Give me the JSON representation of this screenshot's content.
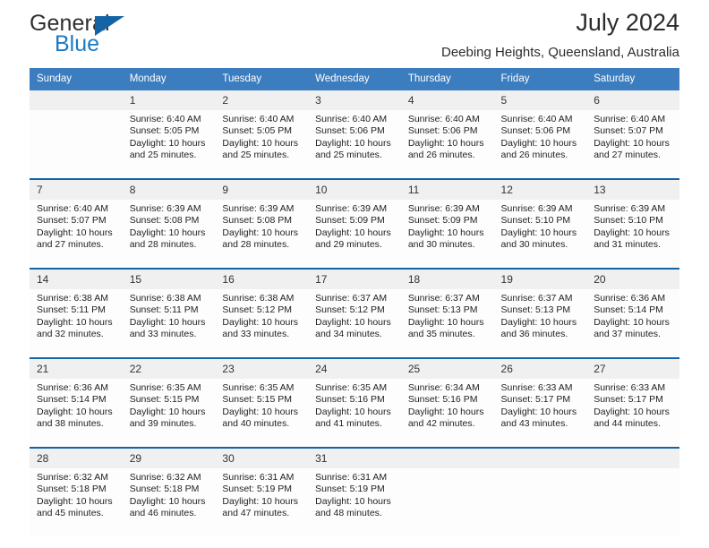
{
  "logo": {
    "word1": "General",
    "word2": "Blue",
    "triangle_color": "#1464a5",
    "blue_color": "#1b7bc4"
  },
  "header": {
    "title": "July 2024",
    "subtitle": "Deebing Heights, Queensland, Australia"
  },
  "theme": {
    "header_blue": "#3b7dbf",
    "separator_blue": "#1464a5",
    "number_band": "#f0f0f0",
    "cell_background": "#fdfdfd"
  },
  "weekdays": [
    "Sunday",
    "Monday",
    "Tuesday",
    "Wednesday",
    "Thursday",
    "Friday",
    "Saturday"
  ],
  "weeks": [
    [
      {
        "day": "",
        "sunrise": "",
        "sunset": "",
        "daylight_line1": "",
        "daylight_line2": ""
      },
      {
        "day": "1",
        "sunrise": "Sunrise: 6:40 AM",
        "sunset": "Sunset: 5:05 PM",
        "daylight_line1": "Daylight: 10 hours",
        "daylight_line2": "and 25 minutes."
      },
      {
        "day": "2",
        "sunrise": "Sunrise: 6:40 AM",
        "sunset": "Sunset: 5:05 PM",
        "daylight_line1": "Daylight: 10 hours",
        "daylight_line2": "and 25 minutes."
      },
      {
        "day": "3",
        "sunrise": "Sunrise: 6:40 AM",
        "sunset": "Sunset: 5:06 PM",
        "daylight_line1": "Daylight: 10 hours",
        "daylight_line2": "and 25 minutes."
      },
      {
        "day": "4",
        "sunrise": "Sunrise: 6:40 AM",
        "sunset": "Sunset: 5:06 PM",
        "daylight_line1": "Daylight: 10 hours",
        "daylight_line2": "and 26 minutes."
      },
      {
        "day": "5",
        "sunrise": "Sunrise: 6:40 AM",
        "sunset": "Sunset: 5:06 PM",
        "daylight_line1": "Daylight: 10 hours",
        "daylight_line2": "and 26 minutes."
      },
      {
        "day": "6",
        "sunrise": "Sunrise: 6:40 AM",
        "sunset": "Sunset: 5:07 PM",
        "daylight_line1": "Daylight: 10 hours",
        "daylight_line2": "and 27 minutes."
      }
    ],
    [
      {
        "day": "7",
        "sunrise": "Sunrise: 6:40 AM",
        "sunset": "Sunset: 5:07 PM",
        "daylight_line1": "Daylight: 10 hours",
        "daylight_line2": "and 27 minutes."
      },
      {
        "day": "8",
        "sunrise": "Sunrise: 6:39 AM",
        "sunset": "Sunset: 5:08 PM",
        "daylight_line1": "Daylight: 10 hours",
        "daylight_line2": "and 28 minutes."
      },
      {
        "day": "9",
        "sunrise": "Sunrise: 6:39 AM",
        "sunset": "Sunset: 5:08 PM",
        "daylight_line1": "Daylight: 10 hours",
        "daylight_line2": "and 28 minutes."
      },
      {
        "day": "10",
        "sunrise": "Sunrise: 6:39 AM",
        "sunset": "Sunset: 5:09 PM",
        "daylight_line1": "Daylight: 10 hours",
        "daylight_line2": "and 29 minutes."
      },
      {
        "day": "11",
        "sunrise": "Sunrise: 6:39 AM",
        "sunset": "Sunset: 5:09 PM",
        "daylight_line1": "Daylight: 10 hours",
        "daylight_line2": "and 30 minutes."
      },
      {
        "day": "12",
        "sunrise": "Sunrise: 6:39 AM",
        "sunset": "Sunset: 5:10 PM",
        "daylight_line1": "Daylight: 10 hours",
        "daylight_line2": "and 30 minutes."
      },
      {
        "day": "13",
        "sunrise": "Sunrise: 6:39 AM",
        "sunset": "Sunset: 5:10 PM",
        "daylight_line1": "Daylight: 10 hours",
        "daylight_line2": "and 31 minutes."
      }
    ],
    [
      {
        "day": "14",
        "sunrise": "Sunrise: 6:38 AM",
        "sunset": "Sunset: 5:11 PM",
        "daylight_line1": "Daylight: 10 hours",
        "daylight_line2": "and 32 minutes."
      },
      {
        "day": "15",
        "sunrise": "Sunrise: 6:38 AM",
        "sunset": "Sunset: 5:11 PM",
        "daylight_line1": "Daylight: 10 hours",
        "daylight_line2": "and 33 minutes."
      },
      {
        "day": "16",
        "sunrise": "Sunrise: 6:38 AM",
        "sunset": "Sunset: 5:12 PM",
        "daylight_line1": "Daylight: 10 hours",
        "daylight_line2": "and 33 minutes."
      },
      {
        "day": "17",
        "sunrise": "Sunrise: 6:37 AM",
        "sunset": "Sunset: 5:12 PM",
        "daylight_line1": "Daylight: 10 hours",
        "daylight_line2": "and 34 minutes."
      },
      {
        "day": "18",
        "sunrise": "Sunrise: 6:37 AM",
        "sunset": "Sunset: 5:13 PM",
        "daylight_line1": "Daylight: 10 hours",
        "daylight_line2": "and 35 minutes."
      },
      {
        "day": "19",
        "sunrise": "Sunrise: 6:37 AM",
        "sunset": "Sunset: 5:13 PM",
        "daylight_line1": "Daylight: 10 hours",
        "daylight_line2": "and 36 minutes."
      },
      {
        "day": "20",
        "sunrise": "Sunrise: 6:36 AM",
        "sunset": "Sunset: 5:14 PM",
        "daylight_line1": "Daylight: 10 hours",
        "daylight_line2": "and 37 minutes."
      }
    ],
    [
      {
        "day": "21",
        "sunrise": "Sunrise: 6:36 AM",
        "sunset": "Sunset: 5:14 PM",
        "daylight_line1": "Daylight: 10 hours",
        "daylight_line2": "and 38 minutes."
      },
      {
        "day": "22",
        "sunrise": "Sunrise: 6:35 AM",
        "sunset": "Sunset: 5:15 PM",
        "daylight_line1": "Daylight: 10 hours",
        "daylight_line2": "and 39 minutes."
      },
      {
        "day": "23",
        "sunrise": "Sunrise: 6:35 AM",
        "sunset": "Sunset: 5:15 PM",
        "daylight_line1": "Daylight: 10 hours",
        "daylight_line2": "and 40 minutes."
      },
      {
        "day": "24",
        "sunrise": "Sunrise: 6:35 AM",
        "sunset": "Sunset: 5:16 PM",
        "daylight_line1": "Daylight: 10 hours",
        "daylight_line2": "and 41 minutes."
      },
      {
        "day": "25",
        "sunrise": "Sunrise: 6:34 AM",
        "sunset": "Sunset: 5:16 PM",
        "daylight_line1": "Daylight: 10 hours",
        "daylight_line2": "and 42 minutes."
      },
      {
        "day": "26",
        "sunrise": "Sunrise: 6:33 AM",
        "sunset": "Sunset: 5:17 PM",
        "daylight_line1": "Daylight: 10 hours",
        "daylight_line2": "and 43 minutes."
      },
      {
        "day": "27",
        "sunrise": "Sunrise: 6:33 AM",
        "sunset": "Sunset: 5:17 PM",
        "daylight_line1": "Daylight: 10 hours",
        "daylight_line2": "and 44 minutes."
      }
    ],
    [
      {
        "day": "28",
        "sunrise": "Sunrise: 6:32 AM",
        "sunset": "Sunset: 5:18 PM",
        "daylight_line1": "Daylight: 10 hours",
        "daylight_line2": "and 45 minutes."
      },
      {
        "day": "29",
        "sunrise": "Sunrise: 6:32 AM",
        "sunset": "Sunset: 5:18 PM",
        "daylight_line1": "Daylight: 10 hours",
        "daylight_line2": "and 46 minutes."
      },
      {
        "day": "30",
        "sunrise": "Sunrise: 6:31 AM",
        "sunset": "Sunset: 5:19 PM",
        "daylight_line1": "Daylight: 10 hours",
        "daylight_line2": "and 47 minutes."
      },
      {
        "day": "31",
        "sunrise": "Sunrise: 6:31 AM",
        "sunset": "Sunset: 5:19 PM",
        "daylight_line1": "Daylight: 10 hours",
        "daylight_line2": "and 48 minutes."
      },
      {
        "day": "",
        "sunrise": "",
        "sunset": "",
        "daylight_line1": "",
        "daylight_line2": ""
      },
      {
        "day": "",
        "sunrise": "",
        "sunset": "",
        "daylight_line1": "",
        "daylight_line2": ""
      },
      {
        "day": "",
        "sunrise": "",
        "sunset": "",
        "daylight_line1": "",
        "daylight_line2": ""
      }
    ]
  ]
}
